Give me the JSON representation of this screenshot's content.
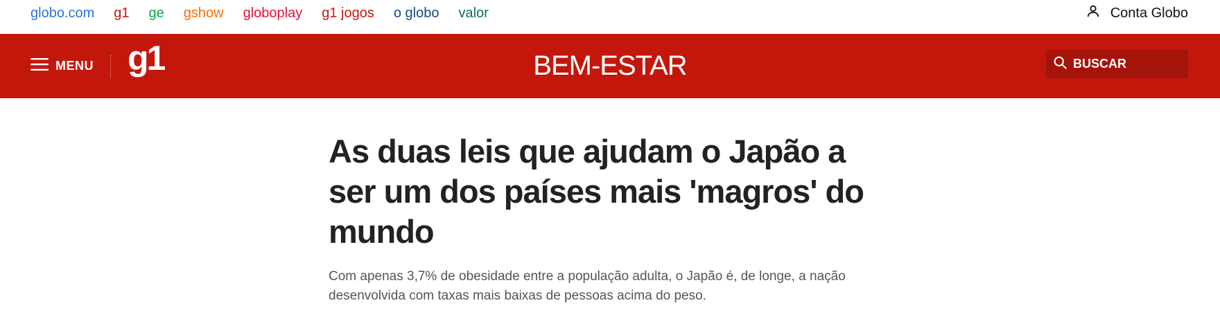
{
  "globo_nav": {
    "items": [
      {
        "label": "globo.com",
        "color": "#2c73d2"
      },
      {
        "label": "g1",
        "color": "#c4170c"
      },
      {
        "label": "ge",
        "color": "#06aa48"
      },
      {
        "label": "gshow",
        "color": "#ff6c00"
      },
      {
        "label": "globoplay",
        "color": "#e1133d"
      },
      {
        "label": "g1 jogos",
        "color": "#c4170c"
      },
      {
        "label": "o globo",
        "color": "#1a4680"
      },
      {
        "label": "valor",
        "color": "#0b6e5c"
      }
    ],
    "account": {
      "label": "Conta Globo",
      "icon": "user-icon"
    }
  },
  "header": {
    "menu_label": "MENU",
    "logo": "g1",
    "section": "BEM-ESTAR",
    "search_label": "BUSCAR",
    "brand_color": "#c4170c"
  },
  "article": {
    "headline": "As duas leis que ajudam o Japão a ser um dos países mais 'magros' do mundo",
    "lede": "Com apenas 3,7% de obesidade entre a população adulta, o Japão é, de longe, a nação desenvolvida com taxas mais baixas de pessoas acima do peso."
  }
}
